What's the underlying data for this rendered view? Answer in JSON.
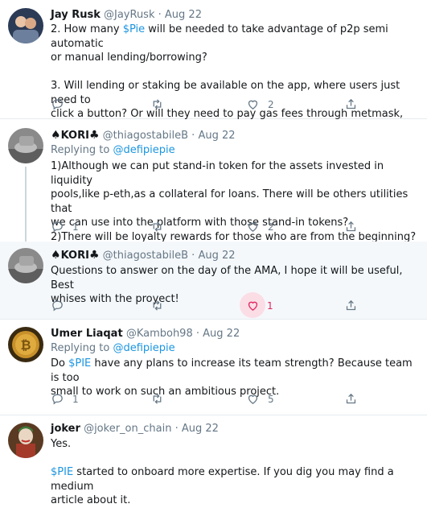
{
  "tweets": [
    {
      "name": "Jay Rusk",
      "handle": "@JayRusk",
      "date": "Aug 22",
      "lines": [
        [
          "2. How many ",
          "$Pie",
          " will be needed to take advantage of p2p semi automatic"
        ],
        [
          "or manual lending/borrowing?"
        ],
        [
          ""
        ],
        [
          "3.  Will lending or staking be available on the app, where users just need to"
        ],
        [
          "click a button?   Or will they need to pay gas fees through metmask, etc?"
        ]
      ],
      "reply_count": "",
      "retweet_count": "",
      "like_count": "2"
    },
    {
      "name_prefix": "♠",
      "name": "KORI",
      "name_suffix": "♣",
      "handle": "@thiagostabileB",
      "date": "Aug 22",
      "replying_label": "Replying to",
      "replying_handle": "@defipiepie",
      "lines": [
        "1)Although we can put stand-in token for the assets invested in liquidity",
        "pools,like p-eth,as a collateral for loans. There will be others utilities that",
        "we can use into the platform with those stand-in tokens?",
        "2)There will be loyalty rewards for those who are from the beginning?"
      ],
      "reply_count": "1",
      "retweet_count": "",
      "like_count": "2"
    },
    {
      "name_prefix": "♠",
      "name": "KORI",
      "name_suffix": "♣",
      "handle": "@thiagostabileB",
      "date": "Aug 22",
      "lines": [
        "Questions to answer on the day of the AMA, I hope it will be useful, Best",
        "whises with the proyect!"
      ],
      "reply_count": "",
      "retweet_count": "",
      "like_count": "1",
      "liked": true
    },
    {
      "name": "Umer Liaqat",
      "handle": "@Kamboh98",
      "date": "Aug 22",
      "replying_label": "Replying to",
      "replying_handle": "@defipiepie",
      "lines": [
        [
          "Do ",
          "$PIE",
          " have any plans to increase its team strength? Because team is too"
        ],
        [
          "small to work on such an ambitious project."
        ]
      ],
      "reply_count": "1",
      "retweet_count": "",
      "like_count": "5"
    },
    {
      "name": "joker",
      "handle": "@joker_on_chain",
      "date": "Aug 22",
      "lines": [
        [
          "Yes."
        ],
        [
          ""
        ],
        [
          "",
          "$PIE",
          " started to onboard more expertise. If you dig you may find a medium"
        ],
        [
          "article about it."
        ]
      ]
    }
  ],
  "colors": {
    "accent": "#1b95e0",
    "muted": "#657786",
    "like": "#e0245e",
    "highlight_bg": "#f5f8fa"
  },
  "icons": [
    "reply-icon",
    "retweet-icon",
    "like-icon",
    "share-icon"
  ]
}
